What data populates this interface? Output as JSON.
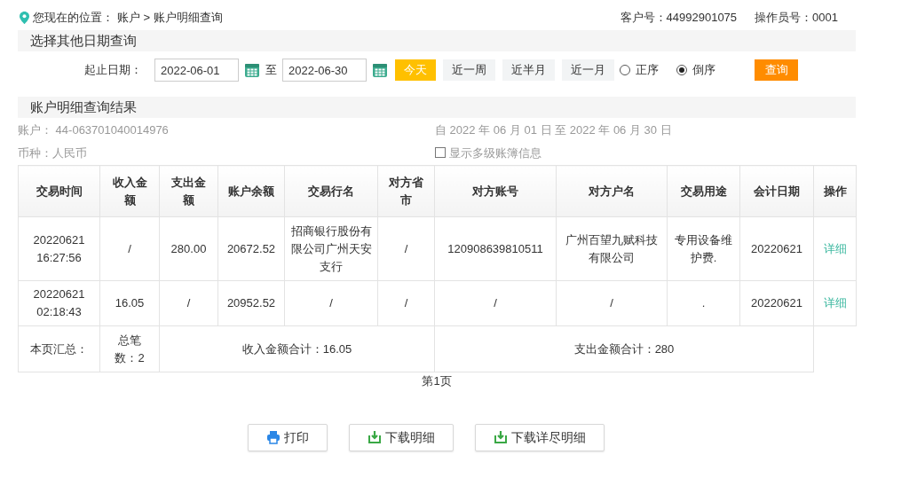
{
  "breadcrumb": {
    "label": "您现在的位置：",
    "path": "账户 > 账户明细查询"
  },
  "header_info": [
    "客户号：44992901075",
    "操作员号：0001"
  ],
  "date_section": {
    "title": "选择其他日期查询",
    "range_label": "起止日期：",
    "start": "2022-06-01",
    "separator": "至",
    "end": "2022-06-30",
    "quick_ranges": [
      {
        "label": "今天",
        "selected": true
      },
      {
        "label": "近一周",
        "selected": false
      },
      {
        "label": "近半月",
        "selected": false
      },
      {
        "label": "近一月",
        "selected": false
      }
    ],
    "orders": [
      {
        "label": "正序",
        "selected": false
      },
      {
        "label": "倒序",
        "selected": true
      }
    ],
    "query_button": "查询"
  },
  "result_section": {
    "title": "账户明细查询结果",
    "account": "账户： 44-063701040014976",
    "period": "自 2022 年 06 月 01 日 至 2022 年 06 月 30 日",
    "currency": "币种：人民币",
    "multi_ledger": {
      "label": "显示多级账簿信息",
      "checked": false
    }
  },
  "table": {
    "columns": [
      "交易时间",
      "收入金额",
      "支出金额",
      "账户余额",
      "交易行名",
      "对方省市",
      "对方账号",
      "对方户名",
      "交易用途",
      "会计日期",
      "操作"
    ],
    "rows": [
      {
        "cells": [
          "20220621 16:27:56",
          "/",
          "280.00",
          "20672.52",
          "招商银行股份有限公司广州天安支行",
          "/",
          "120908639810511",
          "广州百望九赋科技有限公司",
          "专用设备维护费.",
          "20220621"
        ],
        "action": "详细"
      },
      {
        "cells": [
          "20220621 02:18:43",
          "16.05",
          "/",
          "20952.52",
          "/",
          "/",
          "/",
          "/",
          ".",
          "20220621"
        ],
        "action": "详细"
      }
    ],
    "summary": {
      "label": "本页汇总：",
      "count": "总笔数：2",
      "income_total": "收入金额合计：16.05",
      "expense_total": "支出金额合计：280"
    }
  },
  "pagination": "第1页",
  "buttons": [
    {
      "kind": "print",
      "label": "打印"
    },
    {
      "kind": "download",
      "label": "下载明细"
    },
    {
      "kind": "download",
      "label": "下载详尽明细"
    }
  ]
}
